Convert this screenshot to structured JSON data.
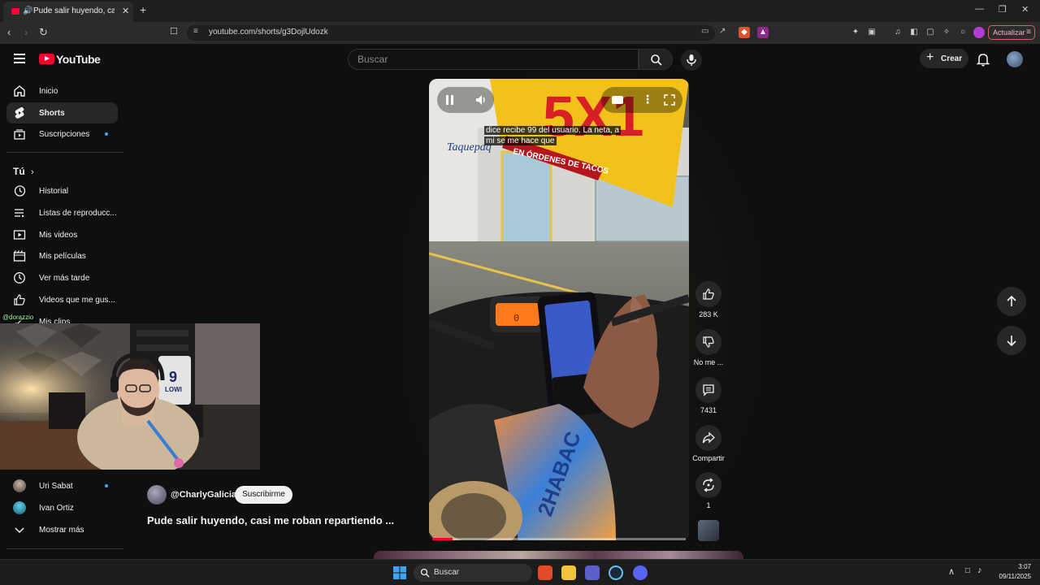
{
  "browser": {
    "tab_title": "Pude salir huyendo, casi me",
    "tab_close": "✕",
    "new_tab": "+",
    "url": "youtube.com/shorts/g3DojlUdozk",
    "update_label": "Actualizar",
    "window_controls": [
      "—",
      "❐",
      "✕"
    ]
  },
  "header": {
    "logo_text": "YouTube",
    "search_placeholder": "Buscar",
    "create_label": "Crear"
  },
  "sidebar": {
    "main": [
      {
        "label": "Inicio",
        "icon": "home-icon"
      },
      {
        "label": "Shorts",
        "icon": "shorts-icon"
      },
      {
        "label": "Suscripciones",
        "icon": "subscriptions-icon"
      }
    ],
    "you_heading": "Tú",
    "you_items": [
      {
        "label": "Historial",
        "icon": "history-icon"
      },
      {
        "label": "Listas de reproducc...",
        "icon": "playlist-icon"
      },
      {
        "label": "Mis videos",
        "icon": "video-icon"
      },
      {
        "label": "Mis películas",
        "icon": "movie-icon"
      },
      {
        "label": "Ver más tarde",
        "icon": "clock-icon"
      },
      {
        "label": "Videos que me gus...",
        "icon": "thumb-up-icon"
      },
      {
        "label": "Mis clips",
        "icon": "clip-icon"
      }
    ],
    "subs": [
      {
        "label": "Uri Sabat"
      },
      {
        "label": "Ivan Ortiz"
      }
    ],
    "show_more": "Mostrar más"
  },
  "webcam": {
    "tag": "@dorazzio",
    "jersey_number": "9",
    "jersey_text": "LOWI"
  },
  "short": {
    "caption_line1": "dice recibe 99 del usuario. La neta, a",
    "caption_line2": "mi se me hace que",
    "sign_text": "EN ÓRDENES DE TACOS",
    "shop_text": "Taquepaq",
    "progress": 0.08,
    "channel": "@CharlyGalicia",
    "subscribe_label": "Suscribirme",
    "title": "Pude salir huyendo, casi me roban repartiendo ..."
  },
  "actions": {
    "likes": "283 K",
    "dislike_label": "No me ...",
    "comments": "7431",
    "share_label": "Compartir",
    "remix_count": "1"
  },
  "taskbar": {
    "search_label": "Buscar",
    "time": "3:07",
    "date": "09/11/2025"
  },
  "colors": {
    "yt_red": "#ff0033",
    "background": "#0f0f0f",
    "accent_blue": "#3ea6ff"
  }
}
